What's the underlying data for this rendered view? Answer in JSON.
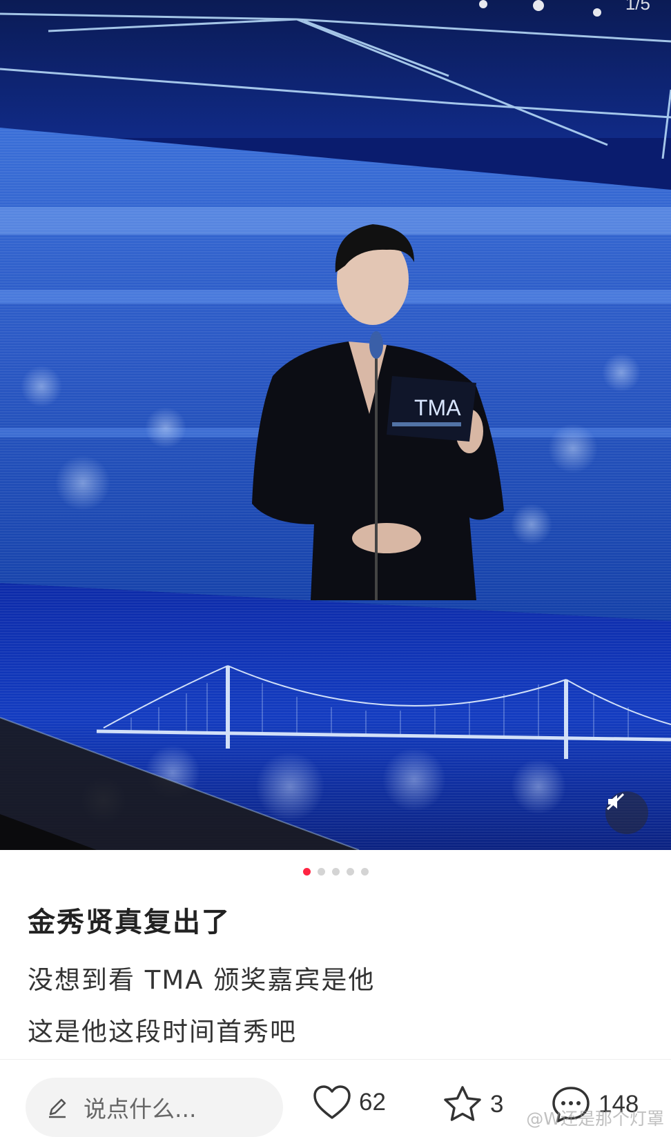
{
  "header": {
    "page_counter": "1/5"
  },
  "carousel": {
    "total": 5,
    "active_index": 0
  },
  "post": {
    "title": "金秀贤真复出了",
    "lines": [
      "没想到看 TMA 颁奖嘉宾是他",
      "这是他这段时间首秀吧"
    ]
  },
  "screen": {
    "card_logo": "TMA"
  },
  "bottom_bar": {
    "comment_placeholder": "说点什么...",
    "like_count": "62",
    "collect_count": "3",
    "comment_count": "148"
  },
  "watermark": "@W还是那个灯罩",
  "colors": {
    "accent": "#ff2442",
    "stage_blue": "#1a3fae"
  },
  "icons": [
    "pencil-icon",
    "heart-icon",
    "star-icon",
    "comment-bubble-icon",
    "mute-icon"
  ]
}
